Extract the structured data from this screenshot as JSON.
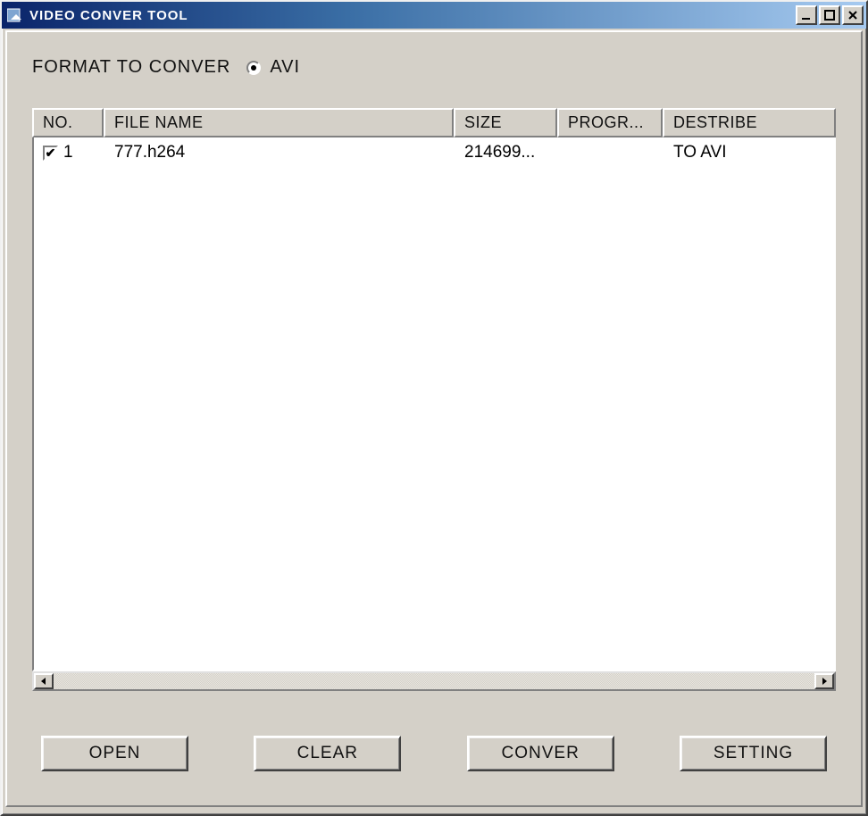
{
  "window": {
    "title": "VIDEO CONVER TOOL"
  },
  "format": {
    "label": "FORMAT TO CONVER",
    "option": "AVI"
  },
  "columns": {
    "no": "NO.",
    "filename": "FILE NAME",
    "size": "SIZE",
    "progress": "PROGR...",
    "describe": "DESTRIBE"
  },
  "rows": [
    {
      "checked": true,
      "no": "1",
      "filename": "777.h264",
      "size": "214699...",
      "progress": "",
      "describe": "TO AVI"
    }
  ],
  "buttons": {
    "open": "OPEN",
    "clear": "CLEAR",
    "conver": "CONVER",
    "setting": "SETTING"
  }
}
